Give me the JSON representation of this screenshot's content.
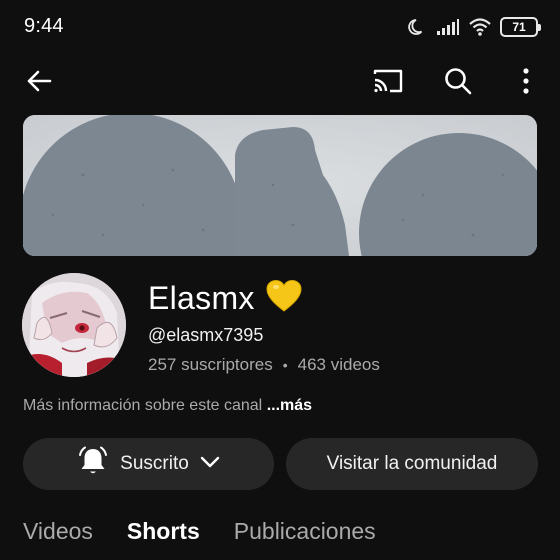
{
  "status_bar": {
    "time": "9:44",
    "battery": "71"
  },
  "app_bar": {
    "icons": [
      "back-arrow-icon",
      "cast-icon",
      "search-icon",
      "more-vert-icon"
    ]
  },
  "channel": {
    "name": "Elasmx",
    "name_emoji": "yellow-heart-icon",
    "handle": "@elasmx7395",
    "subscribers": "257 suscriptores",
    "separator": "•",
    "videos": "463 videos",
    "more_info": "Más información sobre este canal",
    "more_link": "...más"
  },
  "buttons": {
    "subscribed_label": "Suscrito",
    "community_label": "Visitar la comunidad"
  },
  "tabs": [
    {
      "label": "Videos",
      "active": false
    },
    {
      "label": "Shorts",
      "active": true
    },
    {
      "label": "Publicaciones",
      "active": false
    }
  ],
  "colors": {
    "background": "#0f0f0f",
    "button_bg": "#272727",
    "secondary_text": "#aaaaaa",
    "heart": "#f5c518"
  }
}
